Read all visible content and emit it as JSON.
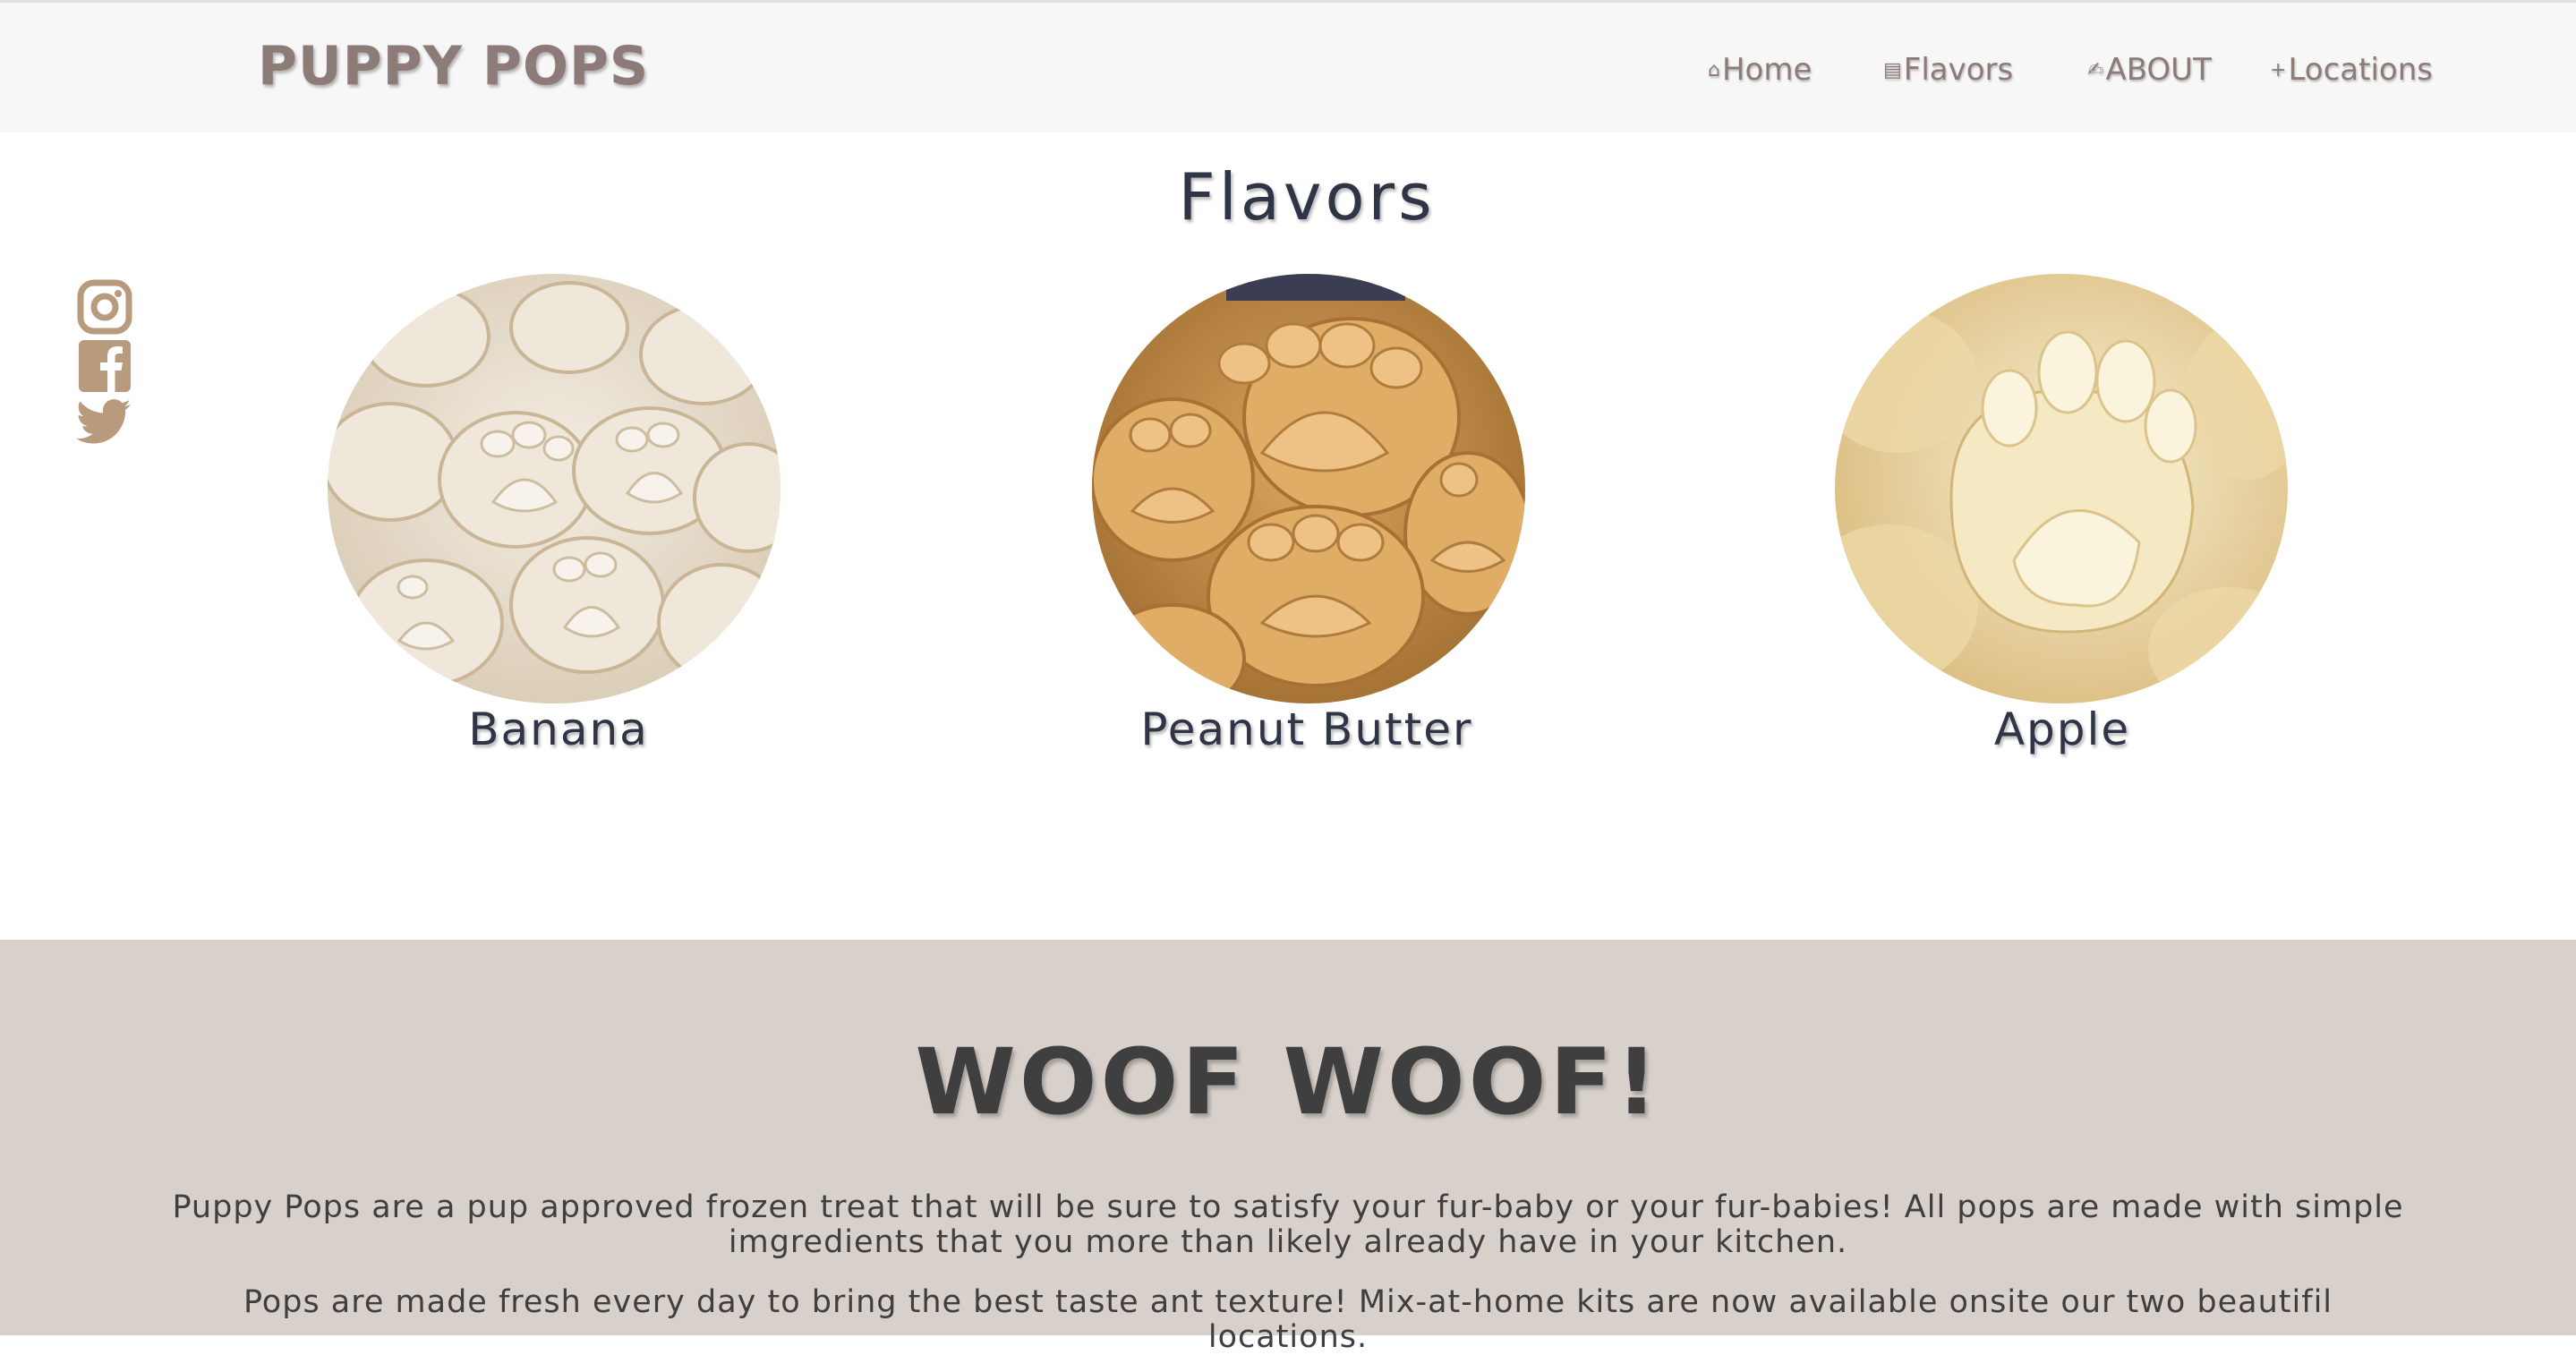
{
  "header": {
    "brand": "PUPPY POPS",
    "nav": [
      {
        "icon": "home-icon",
        "glyph": "⌂",
        "label": "Home"
      },
      {
        "icon": "menu-list-icon",
        "glyph": "▤",
        "label": "Flavors"
      },
      {
        "icon": "pen-icon",
        "glyph": "✍",
        "label": "ABOUT"
      },
      {
        "icon": "plus-icon",
        "glyph": "+",
        "label": "Locations"
      }
    ]
  },
  "social": [
    {
      "icon": "instagram-icon"
    },
    {
      "icon": "facebook-icon"
    },
    {
      "icon": "twitter-icon"
    }
  ],
  "flavors": {
    "title": "Flavors",
    "items": [
      {
        "label": "Banana"
      },
      {
        "label": "Peanut Butter"
      },
      {
        "label": "Apple"
      }
    ]
  },
  "about": {
    "title": "WOOF WOOF!",
    "paragraphs": [
      "Puppy Pops are a pup approved frozen treat that will be sure to satisfy your fur-baby or your fur-babies! All pops are made with simple imgredients that you more than likely already have in your kitchen.",
      "Pops are made fresh every day to bring the best taste ant texture! Mix-at-home kits are now available onsite our two beautifil locations."
    ]
  },
  "colors": {
    "header_bg": "#f7f7f7",
    "brand": "#8c7b76",
    "heading": "#2f3447",
    "social_icon": "#b89a7c",
    "about_bg": "#d8d1cb",
    "about_text": "#3f3f3f"
  }
}
